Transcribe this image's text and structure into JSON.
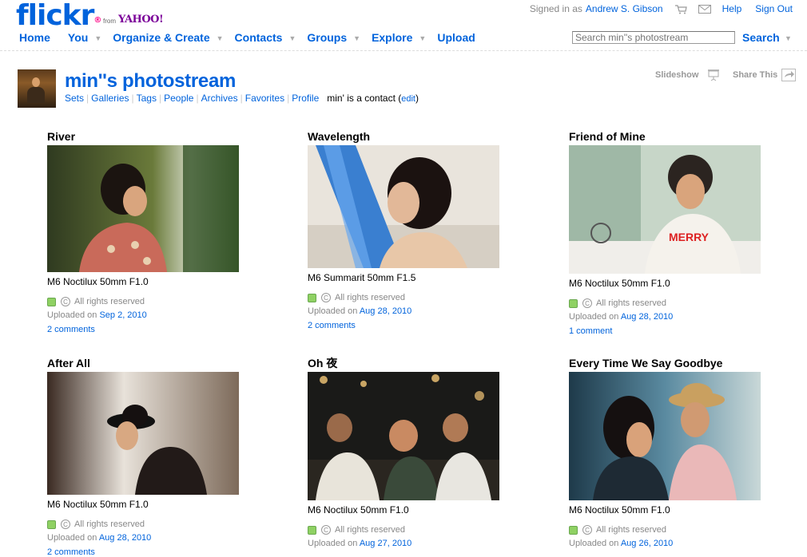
{
  "header": {
    "logo_text": "flickr",
    "logo_reg": "®",
    "from_text": "from",
    "yahoo_text": "YAHOO!",
    "signed_in_as": "Signed in as",
    "user_name": "Andrew S. Gibson",
    "help": "Help",
    "sign_out": "Sign Out"
  },
  "nav": {
    "items": [
      "Home",
      "You",
      "Organize & Create",
      "Contacts",
      "Groups",
      "Explore",
      "Upload"
    ]
  },
  "search": {
    "placeholder": "Search min''s photostream",
    "button": "Search"
  },
  "profile": {
    "title": "min''s photostream",
    "links": [
      "Sets",
      "Galleries",
      "Tags",
      "People",
      "Archives",
      "Favorites",
      "Profile"
    ],
    "contact_text": "min' is a contact (",
    "edit": "edit",
    "contact_close": ")",
    "slideshow": "Slideshow",
    "share": "Share This"
  },
  "photos": [
    {
      "title": "River",
      "desc": "M6 Noctilux 50mm F1.0",
      "rights": "All rights reserved",
      "uploaded": "Uploaded on",
      "date": "Sep 2, 2010",
      "comments": "2 comments"
    },
    {
      "title": "Wavelength",
      "desc": "M6 Summarit 50mm F1.5",
      "rights": "All rights reserved",
      "uploaded": "Uploaded on",
      "date": "Aug 28, 2010",
      "comments": "2 comments"
    },
    {
      "title": "Friend of Mine",
      "desc": "M6 Noctilux 50mm F1.0",
      "rights": "All rights reserved",
      "uploaded": "Uploaded on",
      "date": "Aug 28, 2010",
      "comments": "1 comment"
    },
    {
      "title": "After All",
      "desc": "M6 Noctilux 50mm F1.0",
      "rights": "All rights reserved",
      "uploaded": "Uploaded on",
      "date": "Aug 28, 2010",
      "comments": "2 comments"
    },
    {
      "title": "Oh 夜",
      "desc": "M6 Noctilux 50mm F1.0",
      "rights": "All rights reserved",
      "uploaded": "Uploaded on",
      "date": "Aug 27, 2010",
      "comments": ""
    },
    {
      "title": "Every Time We Say Goodbye",
      "desc": "M6 Noctilux 50mm F1.0",
      "rights": "All rights reserved",
      "uploaded": "Uploaded on",
      "date": "Aug 26, 2010",
      "comments": ""
    }
  ],
  "colors": {
    "link": "#0063dc",
    "accent": "#ff0084",
    "cc_green": "#8fd163"
  }
}
